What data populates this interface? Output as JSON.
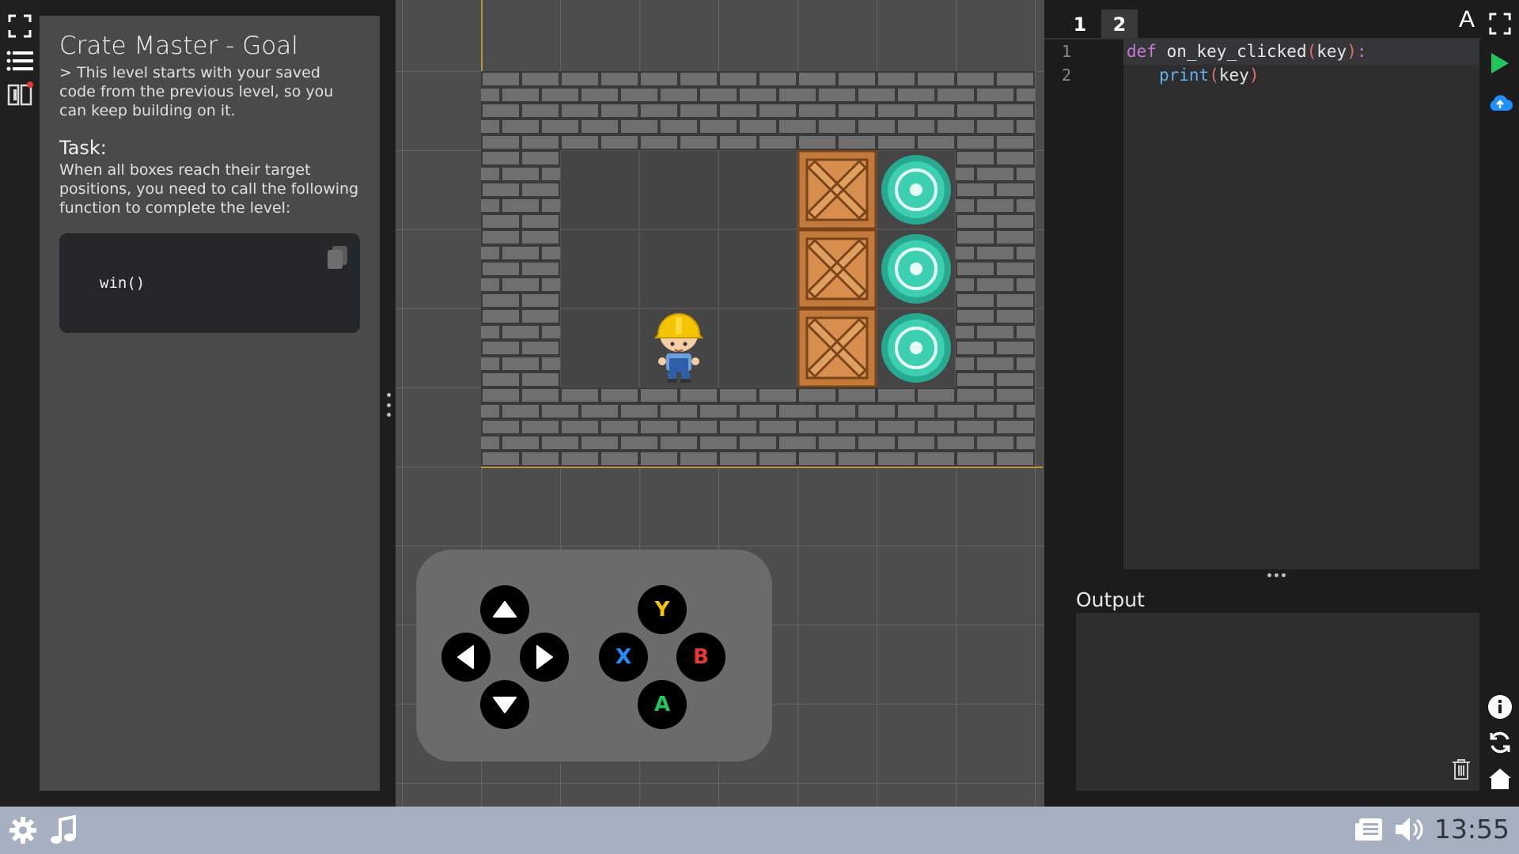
{
  "goal": {
    "title": "Crate Master - Goal",
    "note": "> This level starts with your saved code from the previous level, so you can keep building on it.",
    "task_heading": "Task:",
    "task_text": "When all boxes reach their target positions, you need to call the following function to complete the level:",
    "code_snippet": "win()"
  },
  "gamepad": {
    "y_label": "Y",
    "x_label": "X",
    "b_label": "B",
    "a_label": "A",
    "colors": {
      "y": "#f5c400",
      "x": "#1e90ff",
      "b": "#e53935",
      "a": "#22c55e"
    }
  },
  "editor": {
    "tabs": [
      "1",
      "2"
    ],
    "font_button": "A",
    "line_numbers": [
      "1",
      "2"
    ],
    "line1": {
      "keyword": "def",
      "name": "on_key_clicked",
      "open": "(",
      "param": "key",
      "close": ")",
      "colon": ":"
    },
    "line2": {
      "func": "print",
      "open": "(",
      "arg": "key",
      "close": ")"
    },
    "output_label": "Output",
    "output_text": ""
  },
  "taskbar": {
    "clock": "13:55"
  },
  "icons": {
    "left": [
      "fullscreen-icon",
      "list-icon",
      "book-icon"
    ],
    "right": [
      "fullscreen-icon",
      "run-icon",
      "cloud-upload-icon",
      "info-icon",
      "refresh-icon",
      "home-icon",
      "trash-icon"
    ],
    "taskbar": [
      "gear-icon",
      "music-icon",
      "news-icon",
      "speaker-icon"
    ]
  },
  "level": {
    "player": "builder-character",
    "crates": 3,
    "targets": 3
  }
}
